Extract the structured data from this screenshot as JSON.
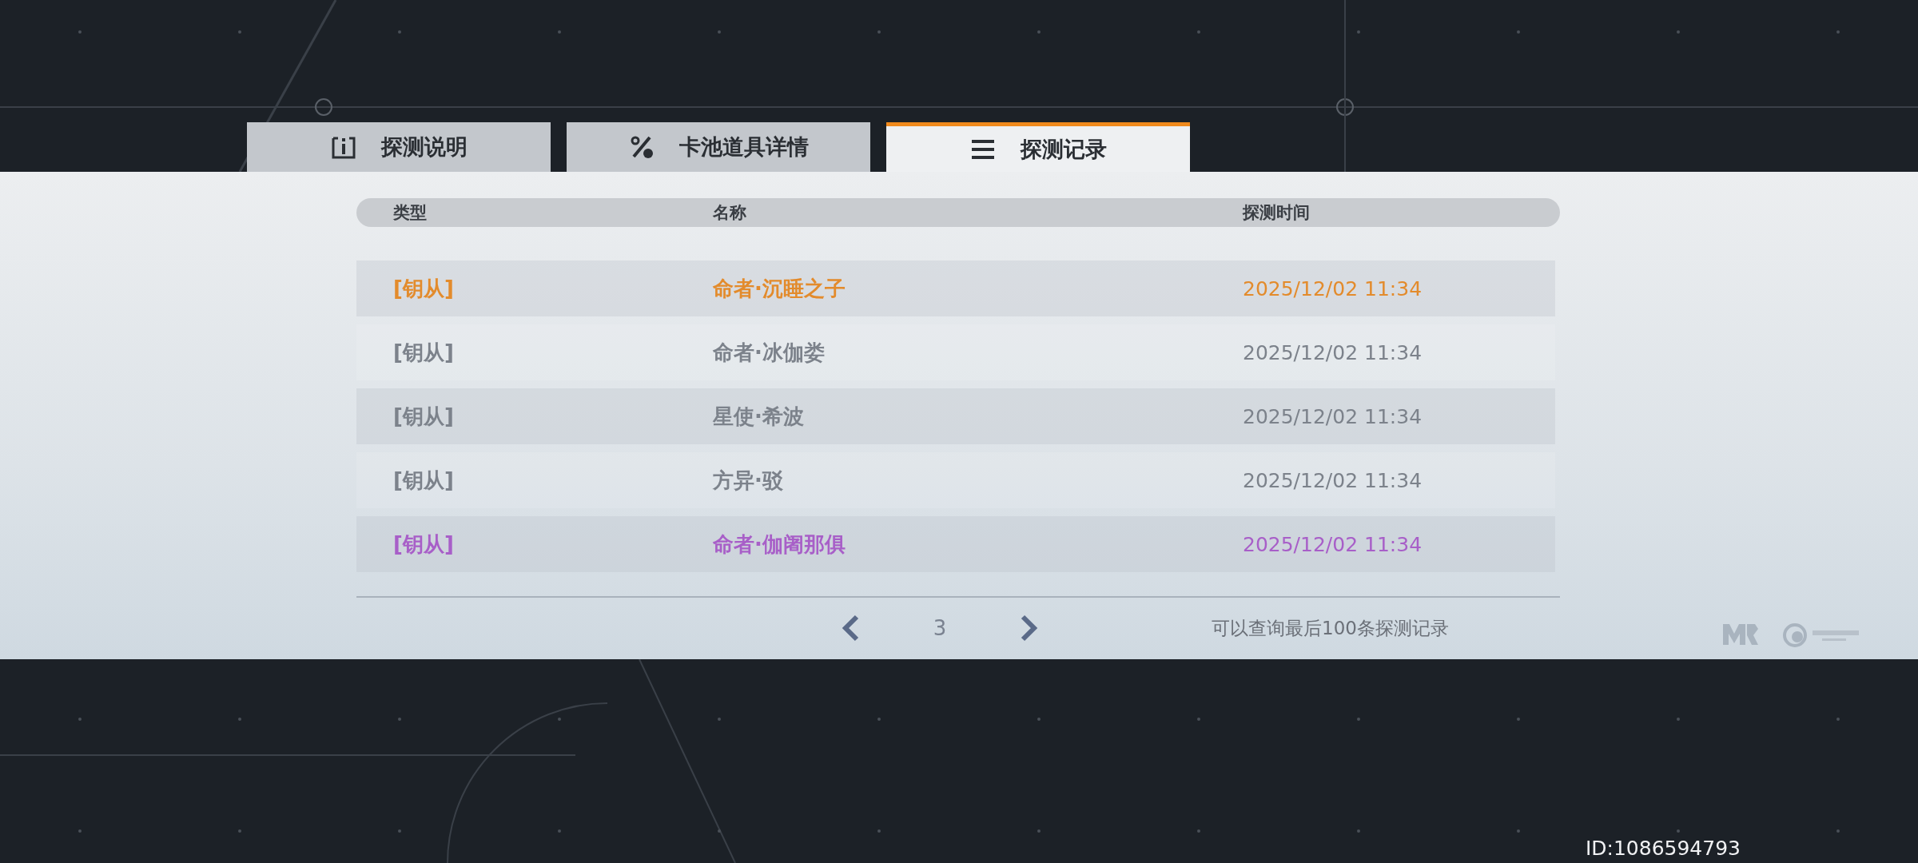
{
  "tabs": [
    {
      "label": "探测说明",
      "kind": "info",
      "selected": false
    },
    {
      "label": "卡池道具详情",
      "kind": "percent",
      "selected": false
    },
    {
      "label": "探测记录",
      "kind": "list",
      "selected": true
    }
  ],
  "table": {
    "columns": [
      "类型",
      "名称",
      "探测时间"
    ],
    "rows": [
      {
        "type": "[钥从]",
        "name": "命者·沉睡之子",
        "time": "2025/12/02 11:34",
        "color": "#e38b2c"
      },
      {
        "type": "[钥从]",
        "name": "命者·冰伽娄",
        "time": "2025/12/02 11:34",
        "color": "#7c828b"
      },
      {
        "type": "[钥从]",
        "name": "星使·希波",
        "time": "2025/12/02 11:34",
        "color": "#7c828b"
      },
      {
        "type": "[钥从]",
        "name": "方异·驳",
        "time": "2025/12/02 11:34",
        "color": "#7c828b"
      },
      {
        "type": "[钥从]",
        "name": "命者·伽阇那俱",
        "time": "2025/12/02 11:34",
        "color": "#a85fc8"
      }
    ]
  },
  "pagination": {
    "page": "3",
    "note": "可以查询最后100条探测记录"
  },
  "user_id": "ID:1086594793"
}
